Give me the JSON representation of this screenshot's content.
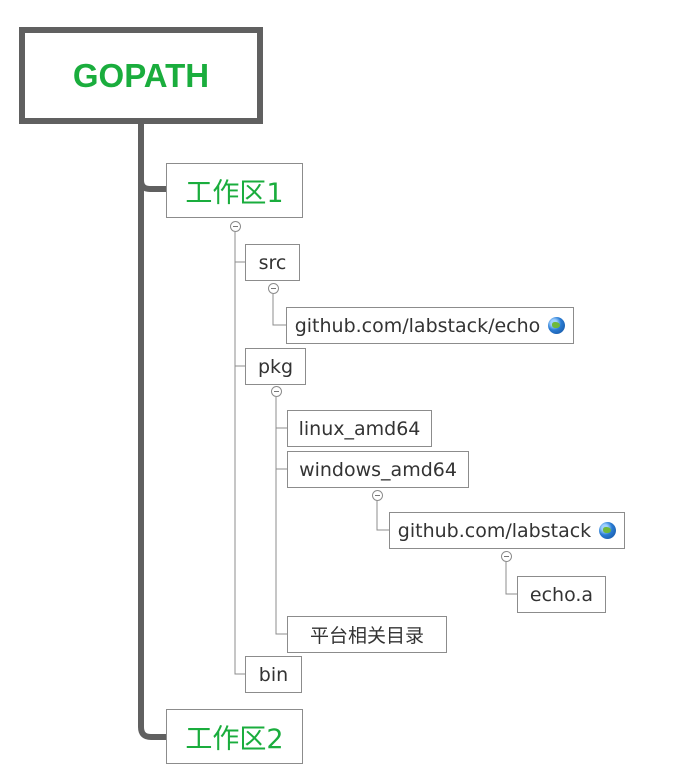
{
  "root": "GOPATH",
  "workspace1": "工作区1",
  "workspace2": "工作区2",
  "src": "src",
  "src_child": "github.com/labstack/echo",
  "pkg": "pkg",
  "pkg_linux": "linux_amd64",
  "pkg_windows": "windows_amd64",
  "windows_child": "github.com/labstack",
  "archive": "echo.a",
  "platform_dir": "平台相关目录",
  "bin": "bin",
  "icons": {
    "link": "globe-icon",
    "collapse": "collapse-minus-icon"
  },
  "colors": {
    "title": "#1aad3d",
    "text": "#333333",
    "border": "#8c8c8c",
    "trunk": "#606060"
  }
}
